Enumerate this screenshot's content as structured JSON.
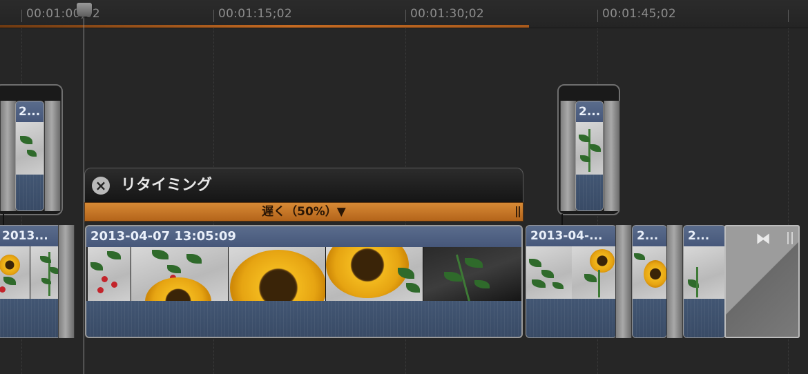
{
  "ruler": {
    "timecodes": [
      "00:01:00;02",
      "00:01:15;02",
      "00:01:30;02",
      "00:01:45;02"
    ]
  },
  "retiming": {
    "title": "リタイミング",
    "close_icon": "close-circle-icon",
    "speed_label": "遅く（50%）▼"
  },
  "clips": {
    "main": "2013-04-07 13:05:09",
    "left": "2013...",
    "right": "2013-04-...",
    "short_a": "2...",
    "short_b": "2...",
    "connected_left": "2...",
    "connected_right": "2..."
  },
  "transition": {
    "icon": "cross-dissolve-icon"
  },
  "colors": {
    "accent_orange": "#c46a22",
    "clip_blue": "#46577a",
    "background": "#262626"
  }
}
